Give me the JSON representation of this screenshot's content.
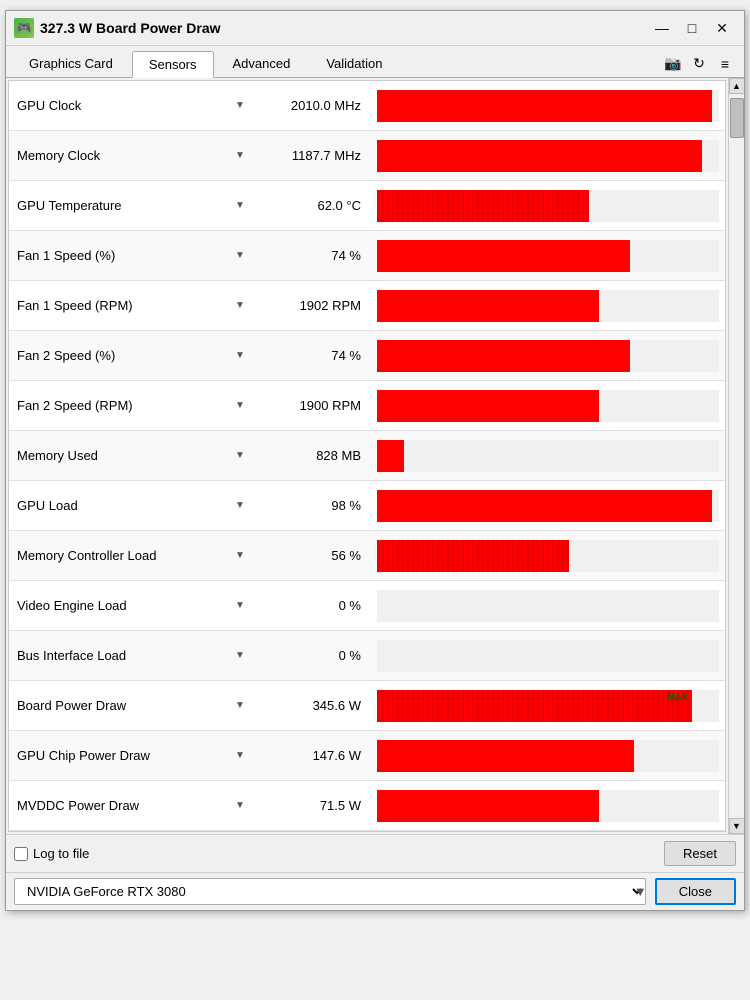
{
  "window": {
    "title": "327.3 W Board Power Draw",
    "icon": "🎮"
  },
  "title_controls": {
    "minimize": "—",
    "maximize": "□",
    "close": "✕"
  },
  "tabs": [
    {
      "id": "graphics-card",
      "label": "Graphics Card",
      "active": false
    },
    {
      "id": "sensors",
      "label": "Sensors",
      "active": true
    },
    {
      "id": "advanced",
      "label": "Advanced",
      "active": false
    },
    {
      "id": "validation",
      "label": "Validation",
      "active": false
    }
  ],
  "toolbar": {
    "camera_icon": "📷",
    "refresh_icon": "↻",
    "menu_icon": "≡"
  },
  "sensors": [
    {
      "name": "GPU Clock",
      "value": "2010.0 MHz",
      "bar_pct": 98,
      "bar_type": "solid_red",
      "has_max": false
    },
    {
      "name": "Memory Clock",
      "value": "1187.7 MHz",
      "bar_pct": 95,
      "bar_type": "solid_red",
      "has_max": false
    },
    {
      "name": "GPU Temperature",
      "value": "62.0 °C",
      "bar_pct": 62,
      "bar_type": "noisy_red",
      "has_max": false
    },
    {
      "name": "Fan 1 Speed (%)",
      "value": "74 %",
      "bar_pct": 74,
      "bar_type": "solid_red",
      "has_max": false
    },
    {
      "name": "Fan 1 Speed (RPM)",
      "value": "1902 RPM",
      "bar_pct": 65,
      "bar_type": "solid_red",
      "has_max": false
    },
    {
      "name": "Fan 2 Speed (%)",
      "value": "74 %",
      "bar_pct": 74,
      "bar_type": "solid_red",
      "has_max": false
    },
    {
      "name": "Fan 2 Speed (RPM)",
      "value": "1900 RPM",
      "bar_pct": 65,
      "bar_type": "solid_red",
      "has_max": false
    },
    {
      "name": "Memory Used",
      "value": "828 MB",
      "bar_pct": 8,
      "bar_type": "empty",
      "has_max": false
    },
    {
      "name": "GPU Load",
      "value": "98 %",
      "bar_pct": 98,
      "bar_type": "solid_red",
      "has_max": false
    },
    {
      "name": "Memory Controller Load",
      "value": "56 %",
      "bar_pct": 56,
      "bar_type": "noisy_red",
      "has_max": false
    },
    {
      "name": "Video Engine Load",
      "value": "0 %",
      "bar_pct": 0,
      "bar_type": "empty",
      "has_max": false
    },
    {
      "name": "Bus Interface Load",
      "value": "0 %",
      "bar_pct": 0,
      "bar_type": "empty",
      "has_max": false
    },
    {
      "name": "Board Power Draw",
      "value": "345.6 W",
      "bar_pct": 92,
      "bar_type": "noisy_red",
      "has_max": true
    },
    {
      "name": "GPU Chip Power Draw",
      "value": "147.6 W",
      "bar_pct": 75,
      "bar_type": "solid_red",
      "has_max": false
    },
    {
      "name": "MVDDC Power Draw",
      "value": "71.5 W",
      "bar_pct": 65,
      "bar_type": "solid_red",
      "has_max": false
    }
  ],
  "bottom": {
    "log_label": "Log to file",
    "reset_label": "Reset"
  },
  "footer": {
    "gpu_name": "NVIDIA GeForce RTX 3080",
    "close_label": "Close"
  }
}
